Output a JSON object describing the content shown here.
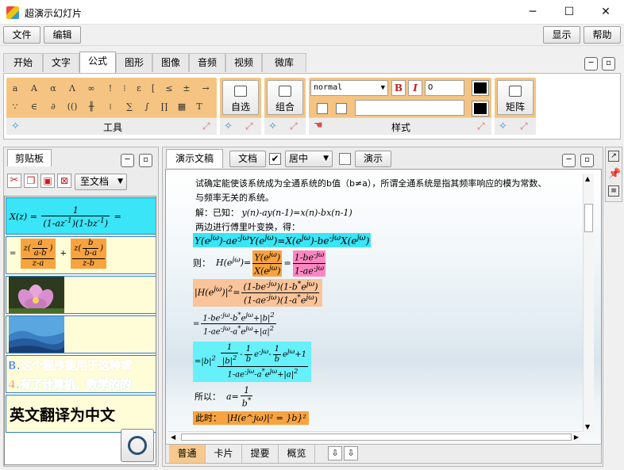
{
  "window": {
    "title": "超演示幻灯片",
    "minimize": "─",
    "maximize": "☐",
    "close": "✕"
  },
  "menubar": {
    "file": "文件",
    "edit": "编辑",
    "view": "显示",
    "help": "帮助"
  },
  "ribbon_tabs": [
    "开始",
    "文字",
    "公式",
    "图形",
    "图像",
    "音频",
    "视频",
    "微库"
  ],
  "ribbon": {
    "symbols_row1": [
      "a",
      "A",
      "α",
      "Λ",
      "∞",
      "!",
      "⁝",
      "ε",
      "[",
      "≤",
      "±",
      "→"
    ],
    "symbols_row2": [
      "∵",
      "∈",
      "∂",
      "(()",
      "╫",
      "⁞",
      "∑",
      "∫",
      "∏",
      "▦",
      "T"
    ],
    "tools_label": "工具",
    "select_label": "自选",
    "group_label": "组合",
    "style_label": "样式",
    "matrix_label": "矩阵",
    "style_select": "normal",
    "bold": "B",
    "italic": "I",
    "spin_value": "0"
  },
  "clipboard": {
    "title": "剪贴板",
    "to_doc": "至文档",
    "slide_text1": "B.这个程序能用于这种或",
    "slide_text2": "4.有了计算机，数学的的",
    "slide_text3": "英文翻译为中文"
  },
  "editor": {
    "tab_presentation": "演示文稿",
    "doc_button": "文档",
    "align_value": "居中",
    "present_button": "演示",
    "line1": "试确定能使该系统成为全通系统的b值（b≠a），所谓全通系统是指其频率响应的模为常数、",
    "line2": "与频率无关的系统。",
    "line3_prefix": "解：已知：",
    "line3_eq": "y(n)-ay(n-1)=x(n)-bx(n-1)",
    "line4": "两边进行傅里叶变换，得：",
    "eq1": "Y(e^jω)-ae^-jω Y(e^jω)=X(e^jω)-be^-jω X(e^jω)",
    "then_label": "则：",
    "so_label": "所以：",
    "now_label": "此时：",
    "now_eq": "|H(e^jω)|² = }b}²"
  },
  "bottom_tabs": [
    "普通",
    "卡片",
    "提要",
    "概览"
  ]
}
